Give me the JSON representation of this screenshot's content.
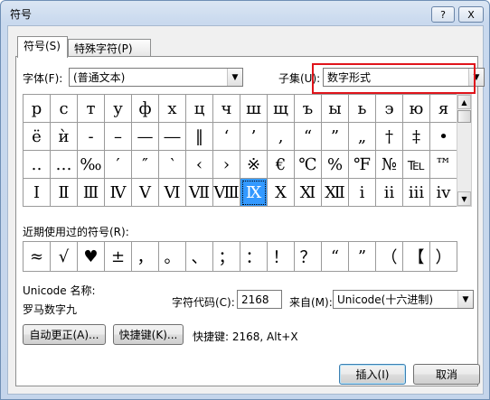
{
  "window": {
    "title": "符号",
    "help_label": "?",
    "close_label": "X"
  },
  "tabs": [
    {
      "label": "符号(S)"
    },
    {
      "label": "特殊字符(P)"
    }
  ],
  "font": {
    "label": "字体(F):",
    "value": "(普通文本)"
  },
  "subset": {
    "label": "子集(U):",
    "value": "数字形式"
  },
  "symbols": [
    [
      "р",
      "с",
      "т",
      "у",
      "ф",
      "х",
      "ц",
      "ч",
      "ш",
      "щ",
      "ъ",
      "ы",
      "ь",
      "э",
      "ю",
      "я"
    ],
    [
      "ё",
      "ѝ",
      "-",
      "–",
      "—",
      "―",
      "‖",
      "‘",
      "’",
      "‚",
      "“",
      "”",
      "„",
      "†",
      "‡",
      "•"
    ],
    [
      "‥",
      "…",
      "‰",
      "′",
      "″",
      "‵",
      "‹",
      "›",
      "※",
      "€",
      "℃",
      "%",
      "℉",
      "№",
      "℡",
      "™"
    ],
    [
      "Ⅰ",
      "Ⅱ",
      "Ⅲ",
      "Ⅳ",
      "Ⅴ",
      "Ⅵ",
      "Ⅶ",
      "Ⅷ",
      "Ⅸ",
      "Ⅹ",
      "Ⅺ",
      "Ⅻ",
      "ⅰ",
      "ⅱ",
      "ⅲ",
      "ⅳ"
    ]
  ],
  "selected_symbol": "Ⅸ",
  "recent": {
    "label": "近期使用过的符号(R):",
    "symbols": [
      "≈",
      "√",
      "♥",
      "±",
      "，",
      "。",
      "、",
      "；",
      "：",
      "！",
      "？",
      "“",
      "”",
      "（",
      "【",
      "）"
    ]
  },
  "unicode_name": {
    "label": "Unicode 名称:",
    "value": "罗马数字九"
  },
  "char_code": {
    "label": "字符代码(C):",
    "value": "2168"
  },
  "from": {
    "label": "来自(M):",
    "value": "Unicode(十六进制)"
  },
  "buttons": {
    "autocorrect": "自动更正(A)...",
    "shortcut_key": "快捷键(K)...",
    "shortcut_text": "快捷键: 2168, Alt+X",
    "insert": "插入(I)",
    "cancel": "取消"
  }
}
